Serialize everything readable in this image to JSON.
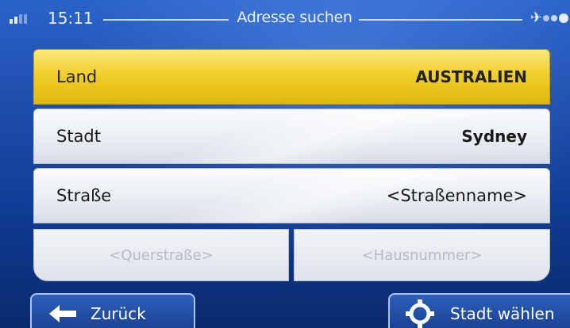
{
  "status": {
    "time": "15:11",
    "title": "Adresse suchen",
    "satellite_icon": "satellite-icon",
    "signal_icon": "signal-strength-icon"
  },
  "rows": {
    "land": {
      "label": "Land",
      "value": "AUSTRALIEN"
    },
    "stadt": {
      "label": "Stadt",
      "value": "Sydney"
    },
    "strasse": {
      "label": "Straße",
      "value": "<Straßenname>"
    },
    "querstrasse": {
      "placeholder": "<Querstraße>"
    },
    "hausnummer": {
      "placeholder": "<Hausnummer>"
    }
  },
  "buttons": {
    "back": {
      "label": "Zurück",
      "icon": "arrow-left-icon"
    },
    "select_city": {
      "label": "Stadt wählen",
      "icon": "crosshair-target-icon"
    }
  },
  "colors": {
    "selected_row": "#f0cf2a",
    "background": "#1f4fae",
    "button_border": "#a9c4f2"
  }
}
